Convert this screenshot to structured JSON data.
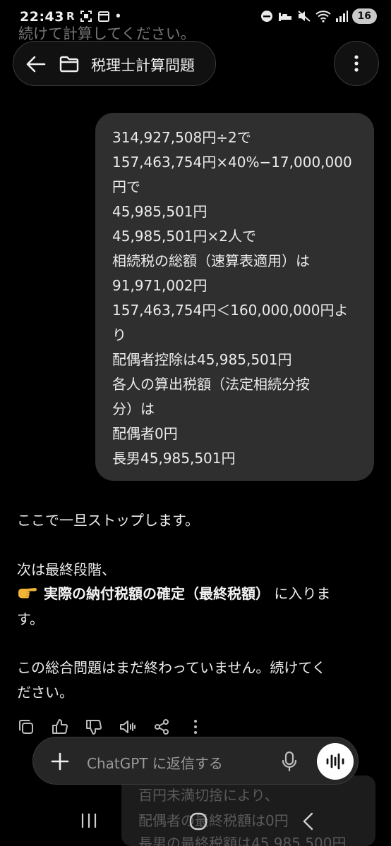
{
  "status_bar": {
    "time": "22:43",
    "left_glyphs": [
      "R",
      "⌷",
      "▦",
      "•"
    ],
    "battery": "16"
  },
  "faded_top_text": "続けて計算してください。",
  "header": {
    "title": "税理士計算問題",
    "back_icon": "back-arrow-icon",
    "folder_icon": "folder-icon",
    "more_icon": "more-vertical-icon"
  },
  "user_message": {
    "lines": [
      "314,927,508円÷2で",
      "157,463,754円×40%−17,000,000",
      "円で",
      "45,985,501円",
      "45,985,501円×2人で",
      "相続税の総額（速算表適用）は",
      "91,971,002円",
      "157,463,754円＜160,000,000円よ",
      "り",
      "配偶者控除は45,985,501円",
      "各人の算出税額（法定相続分按",
      "分）は",
      "配偶者0円",
      "長男45,985,501円"
    ]
  },
  "assistant_message": {
    "line1": "ここで一旦ストップします。",
    "line2": "次は最終段階、",
    "line3_bold": "実際の納付税額の確定（最終税額）",
    "line3_rest": " に入りま",
    "line4": "す。",
    "line5": "この総合問題はまだ終わっていません。続けてく",
    "line6": "ださい。"
  },
  "actions": [
    "copy-icon",
    "thumbs-up-icon",
    "thumbs-down-icon",
    "read-aloud-icon",
    "share-icon",
    "more-vertical-icon"
  ],
  "composer": {
    "placeholder": "ChatGPT に返信する"
  },
  "faded_preview": {
    "lines": [
      "百円未満切捨により、",
      "配偶者の最終税額は0円",
      "長男の最終税額は45,985,500円"
    ]
  },
  "colors": {
    "background": "#000000",
    "bubble": "#2f2f2f",
    "text": "#ececec",
    "composer": "#262626"
  }
}
